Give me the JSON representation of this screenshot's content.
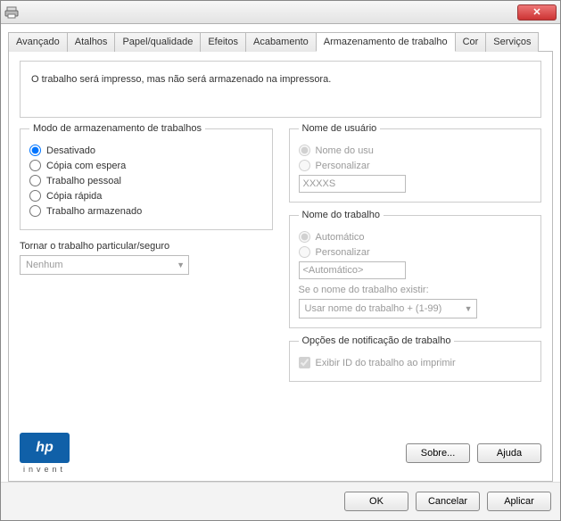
{
  "titlebar": {
    "title": ""
  },
  "tabs": {
    "items": [
      {
        "label": "Avançado"
      },
      {
        "label": "Atalhos"
      },
      {
        "label": "Papel/qualidade"
      },
      {
        "label": "Efeitos"
      },
      {
        "label": "Acabamento"
      },
      {
        "label": "Armazenamento de trabalho"
      },
      {
        "label": "Cor"
      },
      {
        "label": "Serviços"
      }
    ],
    "active": 5
  },
  "info_text": "O trabalho será impresso, mas não será armazenado na impressora.",
  "storage_mode": {
    "legend": "Modo de armazenamento de trabalhos",
    "options": {
      "off": "Desativado",
      "proof": "Cópia com espera",
      "personal": "Trabalho pessoal",
      "quick": "Cópia rápida",
      "stored": "Trabalho armazenado"
    },
    "selected": "off"
  },
  "secure": {
    "label": "Tornar o trabalho particular/seguro",
    "value": "Nenhum"
  },
  "username": {
    "legend": "Nome de usuário",
    "opt_user": "Nome do usu",
    "opt_custom": "Personalizar",
    "value": "XXXXS"
  },
  "jobname": {
    "legend": "Nome do trabalho",
    "opt_auto": "Automático",
    "opt_custom": "Personalizar",
    "value": "<Automático>",
    "exists_label": "Se o nome do trabalho existir:",
    "exists_value": "Usar nome do trabalho + (1-99)"
  },
  "notify": {
    "legend": "Opções de notificação de trabalho",
    "checkbox": "Exibir ID do trabalho ao imprimir"
  },
  "buttons": {
    "about": "Sobre...",
    "help": "Ajuda",
    "ok": "OK",
    "cancel": "Cancelar",
    "apply": "Aplicar"
  },
  "logo": {
    "brand": "hp",
    "tag": "invent"
  }
}
